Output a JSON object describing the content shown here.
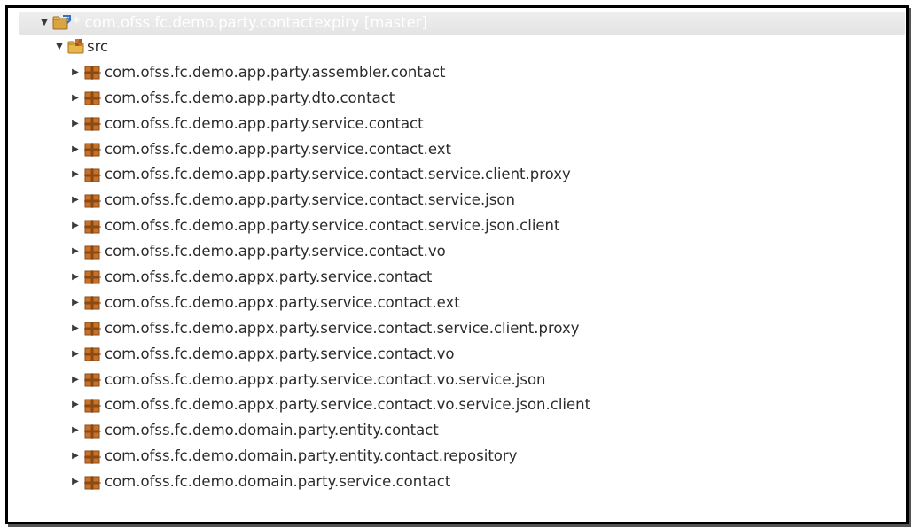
{
  "tree": {
    "project": {
      "label": "* com.ofss.fc.demo.party.contactexpiry [master]",
      "icon": "project-icon",
      "expanded": true
    },
    "folder": {
      "label": "src",
      "icon": "source-folder-icon",
      "expanded": true
    },
    "packages": [
      "com.ofss.fc.demo.app.party.assembler.contact",
      "com.ofss.fc.demo.app.party.dto.contact",
      "com.ofss.fc.demo.app.party.service.contact",
      "com.ofss.fc.demo.app.party.service.contact.ext",
      "com.ofss.fc.demo.app.party.service.contact.service.client.proxy",
      "com.ofss.fc.demo.app.party.service.contact.service.json",
      "com.ofss.fc.demo.app.party.service.contact.service.json.client",
      "com.ofss.fc.demo.app.party.service.contact.vo",
      "com.ofss.fc.demo.appx.party.service.contact",
      "com.ofss.fc.demo.appx.party.service.contact.ext",
      "com.ofss.fc.demo.appx.party.service.contact.service.client.proxy",
      "com.ofss.fc.demo.appx.party.service.contact.vo",
      "com.ofss.fc.demo.appx.party.service.contact.vo.service.json",
      "com.ofss.fc.demo.appx.party.service.contact.vo.service.json.client",
      "com.ofss.fc.demo.domain.party.entity.contact",
      "com.ofss.fc.demo.domain.party.entity.contact.repository",
      "com.ofss.fc.demo.domain.party.service.contact"
    ],
    "glyphs": {
      "expanded": "▼",
      "collapsed": "▶"
    }
  },
  "colors": {
    "package_icon_main": "#c8712b",
    "package_icon_shadow": "#8a4a14",
    "folder_icon": "#e8b64a",
    "project_icon": "#d9a441",
    "text": "#2b2b2b"
  }
}
